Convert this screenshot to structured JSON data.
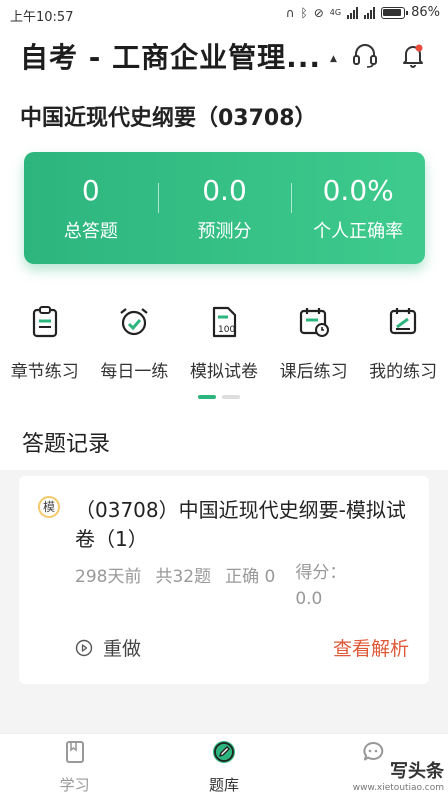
{
  "status_bar": {
    "time": "上午10:57",
    "battery": "86%",
    "net": "4G"
  },
  "header": {
    "title": "自考 - 工商企业管理...",
    "caret": "▲",
    "icons": [
      "headset-icon",
      "bell-icon"
    ]
  },
  "subject": {
    "title": "中国近现代史纲要（03708）"
  },
  "stats": [
    {
      "value": "0",
      "label": "总答题"
    },
    {
      "value": "0.0",
      "label": "预测分"
    },
    {
      "value": "0.0%",
      "label": "个人正确率"
    }
  ],
  "actions": [
    {
      "label": "章节练习",
      "icon": "chapter-icon"
    },
    {
      "label": "每日一练",
      "icon": "alarm-clock-icon"
    },
    {
      "label": "模拟试卷",
      "icon": "exam-paper-icon"
    },
    {
      "label": "课后练习",
      "icon": "calendar-clock-icon"
    },
    {
      "label": "我的练习",
      "icon": "my-practice-icon"
    }
  ],
  "record_section": {
    "title": "答题记录"
  },
  "record": {
    "badge": "模",
    "title": "（03708）中国近现代史纲要-模拟试卷（1）",
    "days_ago": "298天前",
    "total": "共32题",
    "correct": "正确 0",
    "score": "得分：0.0",
    "redo": "重做",
    "analysis": "查看解析"
  },
  "bottom_nav": [
    {
      "label": "学习",
      "icon": "book-icon"
    },
    {
      "label": "题库",
      "icon": "pencil-icon"
    },
    {
      "label": "",
      "icon": "chat-bubble-icon"
    }
  ],
  "watermark": {
    "main": "写头条",
    "url": "www.xietoutiao.com"
  },
  "colors": {
    "accent": "#2db57e",
    "analysis": "#e05a3a"
  }
}
